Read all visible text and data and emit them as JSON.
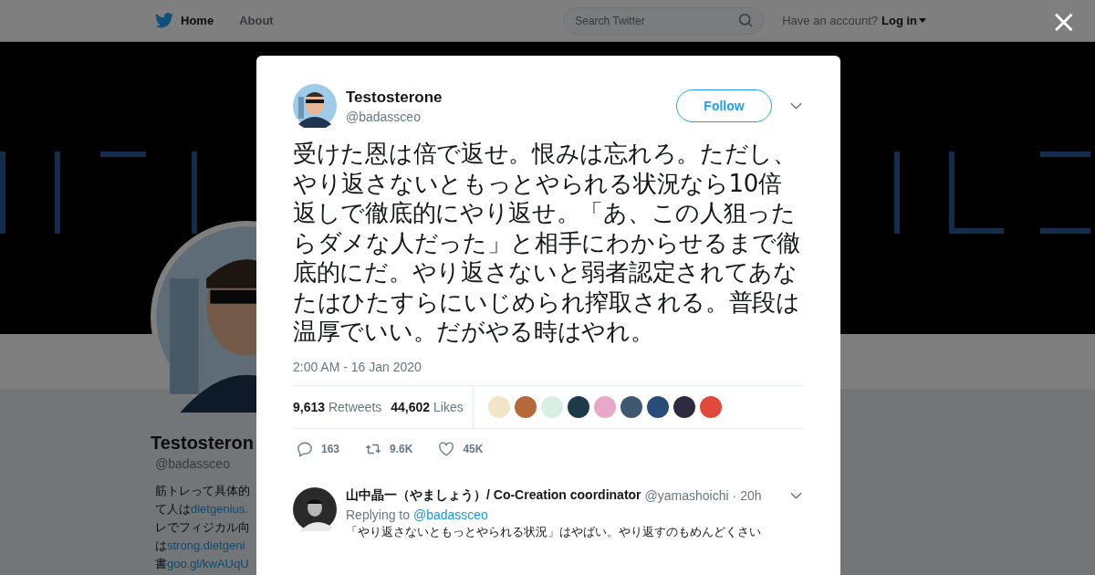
{
  "nav": {
    "links": [
      {
        "label": "Home",
        "selected": true
      },
      {
        "label": "About",
        "selected": false
      }
    ],
    "search": {
      "placeholder": "Search Twitter"
    },
    "account_prompt": "Have an account?",
    "login": "Log in"
  },
  "profile": {
    "name": "Testosteron",
    "handle": "@badassceo",
    "bio": [
      {
        "text": "筋トレって具体的"
      },
      {
        "text": "て人は",
        "link": "dietgenius."
      },
      {
        "text": "レでフィジカル向"
      },
      {
        "text": "は",
        "link": "strong.dietgeni"
      },
      {
        "text": "書",
        "link": "goo.gl/kwAUqU"
      }
    ]
  },
  "close": "×",
  "tweet": {
    "name": "Testosterone",
    "handle": "@badassceo",
    "follow": "Follow",
    "text": "受けた恩は倍で返せ。恨みは忘れろ。ただし、やり返さないともっとやられる状況なら10倍返しで徹底的にやり返せ。「あ、この人狙ったらダメな人だった」と相手にわからせるまで徹底的にだ。やり返さないと弱者認定されてあなたはひたすらにいじめられ搾取される。普段は温厚でいい。だがやる時はやれ。",
    "time": "2:00 AM - 16 Jan 2020",
    "stats": [
      {
        "count": "9,613",
        "label": "Retweets"
      },
      {
        "count": "44,602",
        "label": "Likes"
      }
    ],
    "likers": [
      {
        "color": "#f3e6c8"
      },
      {
        "color": "#b5693a"
      },
      {
        "color": "#d8f0e4"
      },
      {
        "color": "#1d3a4a"
      },
      {
        "color": "#e8a8c8"
      },
      {
        "color": "#3d5870"
      },
      {
        "color": "#2a4c78"
      },
      {
        "color": "#302a40"
      },
      {
        "color": "#e04a3a"
      }
    ],
    "actions": [
      {
        "kind": "reply",
        "count": "163"
      },
      {
        "kind": "retweet",
        "count": "9.6K"
      },
      {
        "kind": "like",
        "count": "45K"
      }
    ]
  },
  "reply": {
    "name": "山中晶一（やましょう）/ Co-Creation coordinator",
    "handle": "@yamashoichi",
    "separator": "·",
    "time": "20h",
    "replying_label": "Replying to",
    "replying_to": "@badassceo",
    "text": "「やり返さないともっとやられる状況」はやばい。やり返すのもめんどくさい"
  }
}
